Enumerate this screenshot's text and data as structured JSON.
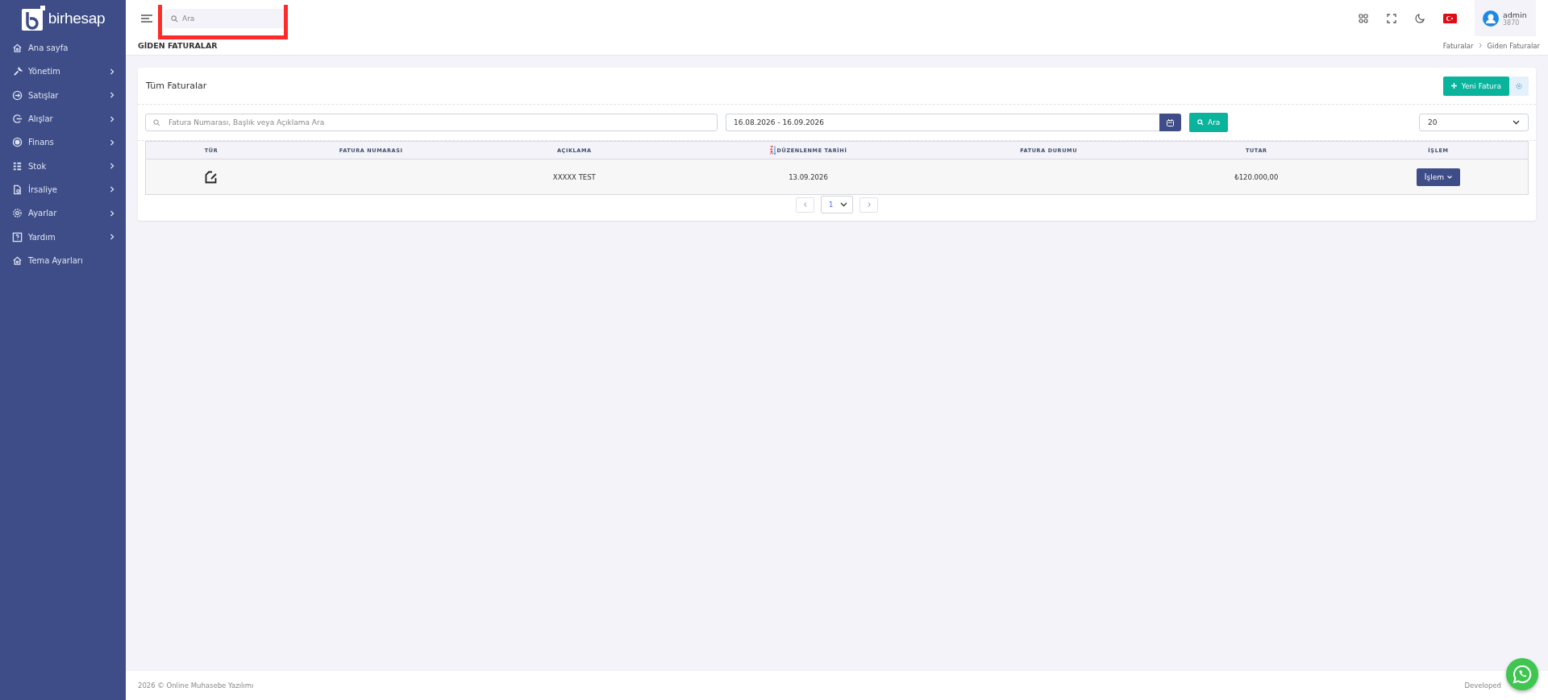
{
  "sidebar": {
    "logo": "birhesap",
    "items": [
      {
        "label": "Ana sayfa",
        "has_submenu": false
      },
      {
        "label": "Yönetim",
        "has_submenu": true
      },
      {
        "label": "Satışlar",
        "has_submenu": true
      },
      {
        "label": "Alışlar",
        "has_submenu": true
      },
      {
        "label": "Finans",
        "has_submenu": true
      },
      {
        "label": "Stok",
        "has_submenu": true
      },
      {
        "label": "İrsaliye",
        "has_submenu": true
      },
      {
        "label": "Ayarlar",
        "has_submenu": true
      },
      {
        "label": "Yardım",
        "has_submenu": true
      },
      {
        "label": "Tema Ayarları",
        "has_submenu": false
      }
    ]
  },
  "topbar": {
    "search": {
      "placeholder": "Ara",
      "highlighted": true
    },
    "user": {
      "name": "admin",
      "id": "3870"
    }
  },
  "page_title": "GİDEN FATURALAR",
  "breadcrumb": [
    "Faturalar",
    "Giden Faturalar"
  ],
  "card": {
    "title": "Tüm Faturalar",
    "new_button": "Yeni Fatura",
    "filters": {
      "search_placeholder": "Fatura Numarası, Başlık veya Açıklama Ara",
      "date_range": "16.08.2026 - 16.09.2026",
      "search_button": "Ara",
      "page_size": "20"
    },
    "table": {
      "columns": [
        {
          "label": "TÜR",
          "sorted": false
        },
        {
          "label": "FATURA NUMARASI",
          "sorted": false
        },
        {
          "label": "AÇIKLAMA",
          "sorted": false
        },
        {
          "label": "DÜZENLENME TARİHİ",
          "sorted": true
        },
        {
          "label": "FATURA DURUMU",
          "sorted": false
        },
        {
          "label": "TUTAR",
          "sorted": false
        },
        {
          "label": "İŞLEM",
          "sorted": false
        }
      ],
      "rows": [
        {
          "description": "XXXXX TEST",
          "date": "13.09.2026",
          "amount": "₺120.000,00",
          "action": "İşlem"
        }
      ]
    },
    "pagination": {
      "page": "1"
    }
  },
  "footer": {
    "left": "2026 © Online Muhasebe Yazılımı",
    "right": "Developed"
  }
}
